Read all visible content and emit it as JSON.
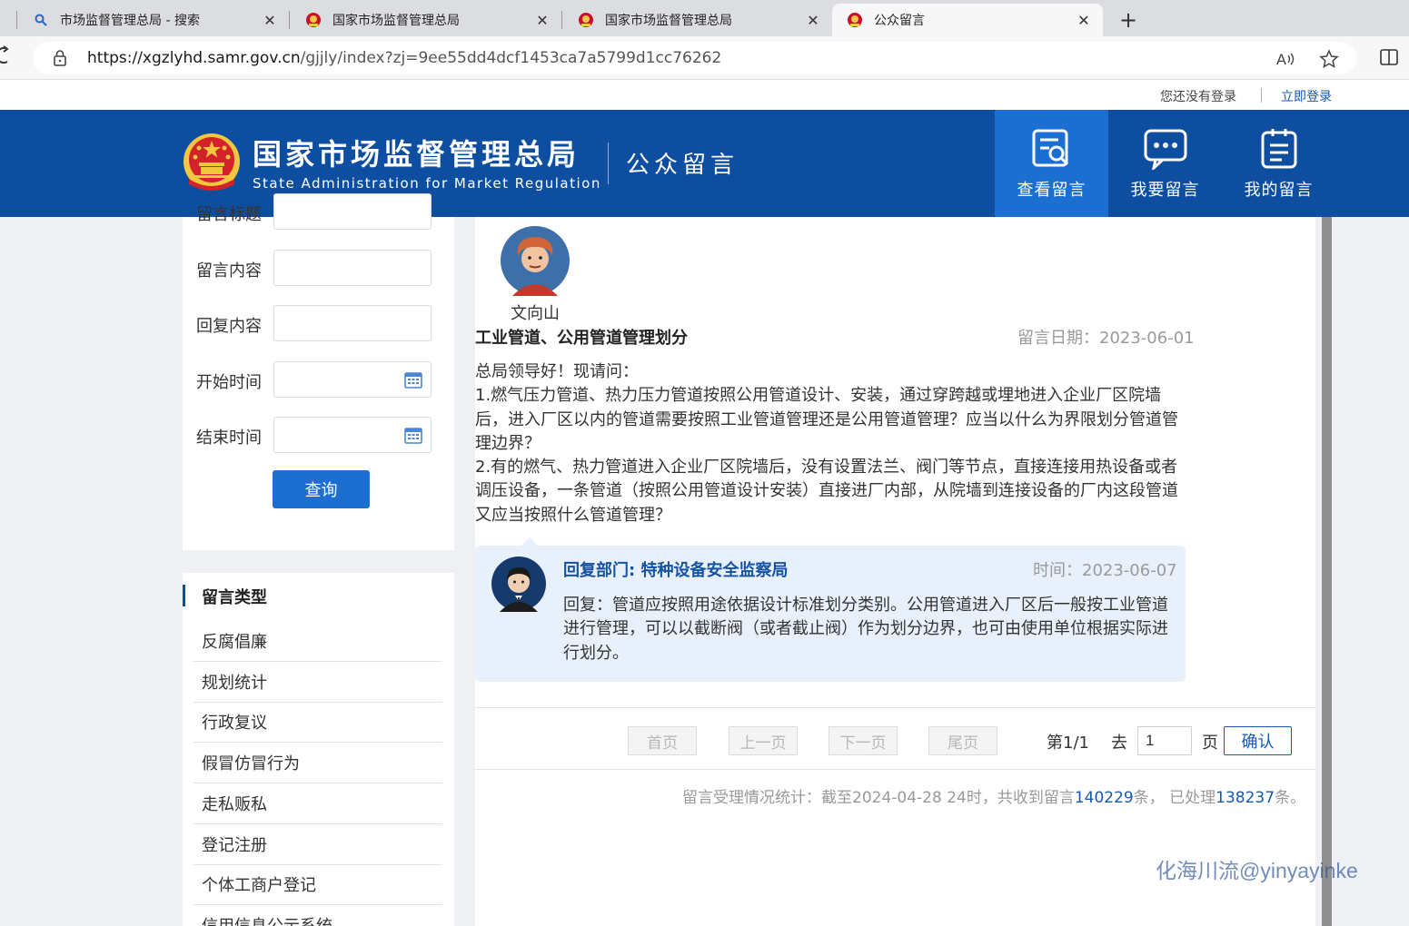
{
  "browser": {
    "tabs": [
      {
        "title": "市场监督管理总局 - 搜索",
        "icon": "search-icon"
      },
      {
        "title": "国家市场监督管理总局",
        "icon": "emblem-icon"
      },
      {
        "title": "国家市场监督管理总局",
        "icon": "emblem-icon"
      },
      {
        "title": "公众留言",
        "icon": "emblem-icon",
        "active": true
      }
    ],
    "url_host": "https://xgzlyhd.samr.gov.cn",
    "url_path": "/gjjly/index?zj=9ee55dd4dcf1453ca7a5799d1cc76262"
  },
  "login": {
    "status": "您还没有登录",
    "link": "立即登录"
  },
  "header": {
    "org_cn": "国家市场监督管理总局",
    "org_en": "State Administration for Market Regulation",
    "section": "公众留言",
    "nav": [
      {
        "label": "查看留言",
        "icon": "search-doc-icon",
        "active": true
      },
      {
        "label": "我要留言",
        "icon": "chat-bubble-icon"
      },
      {
        "label": "我的留言",
        "icon": "clipboard-icon"
      }
    ]
  },
  "filter": {
    "fields": [
      {
        "label": "留言标题",
        "value": ""
      },
      {
        "label": "留言内容",
        "value": ""
      },
      {
        "label": "回复内容",
        "value": ""
      },
      {
        "label": "开始时间",
        "value": ""
      },
      {
        "label": "结束时间",
        "value": ""
      }
    ],
    "query_button": "查询"
  },
  "types": {
    "heading": "留言类型",
    "items": [
      "反腐倡廉",
      "规划统计",
      "行政复议",
      "假冒仿冒行为",
      "走私贩私",
      "登记注册",
      "个体工商户登记",
      "信用信息公示系统"
    ]
  },
  "message": {
    "author": "文向山",
    "title": "工业管道、公用管道管理划分",
    "date_label": "留言日期：2023-06-01",
    "body": "总局领导好！现请问：\n1.燃气压力管道、热力压力管道按照公用管道设计、安装，通过穿跨越或埋地进入企业厂区院墙后，进入厂区以内的管道需要按照工业管道管理还是公用管道管理？应当以什么为界限划分管道管理边界？\n2.有的燃气、热力管道进入企业厂区院墙后，没有设置法兰、阀门等节点，直接连接用热设备或者调压设备，一条管道（按照公用管道设计安装）直接进厂内部，从院墙到连接设备的厂内这段管道又应当按照什么管道管理？"
  },
  "reply": {
    "dept": "回复部门: 特种设备安全监察局",
    "time": "时间：2023-06-07",
    "text": "回复：管道应按照用途依据设计标准划分类别。公用管道进入厂区后一般按工业管道进行管理，可以以截断阀（或者截止阀）作为划分边界，也可由使用单位根据实际进行划分。"
  },
  "pager": {
    "first": "首页",
    "prev": "上一页",
    "next": "下一页",
    "last": "尾页",
    "page_info": "第1/1",
    "goto": "去",
    "page_value": "1",
    "page_unit": "页",
    "confirm": "确认"
  },
  "stats": {
    "prefix": "留言受理情况统计：截至2024-04-28 24时，共收到留言",
    "received": "140229",
    "mid": "条，  已处理",
    "processed": "138237",
    "suffix": "条。"
  },
  "watermark": "化海川流@yinyayinke",
  "colors": {
    "brand_blue": "#0d4ea1",
    "active_nav": "#1a6fd0",
    "link_blue": "#1659b3"
  }
}
